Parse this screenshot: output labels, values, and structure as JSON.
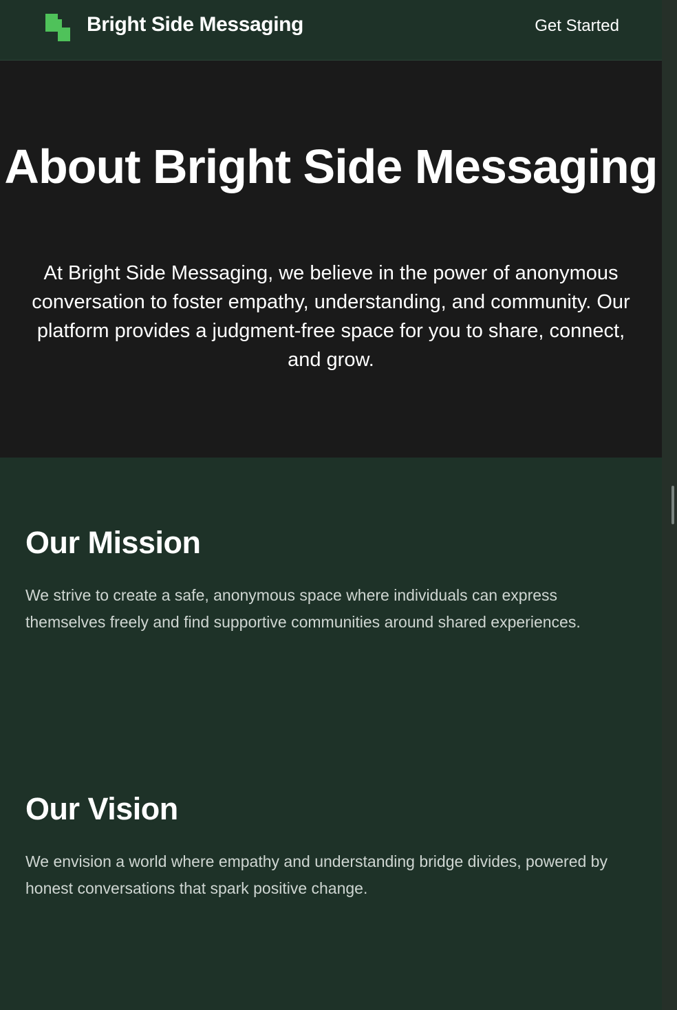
{
  "header": {
    "brand": "Bright Side Messaging",
    "cta_label": "Get Started",
    "logo_icon": "stacked-squares-logo-icon"
  },
  "hero": {
    "title": "About Bright Side Messaging",
    "description": "At Bright Side Messaging, we believe in the power of anonymous conversation to foster empathy, understanding, and community. Our platform provides a judgment-free space for you to share, connect, and grow."
  },
  "mission": {
    "heading": "Our Mission",
    "body": "We strive to create a safe, anonymous space where individuals can express themselves freely and find supportive communities around shared experiences."
  },
  "vision": {
    "heading": "Our Vision",
    "body": "We envision a world where empathy and understanding bridge divides, powered by honest conversations that spark positive change."
  },
  "colors": {
    "accent": "#4fc25a",
    "header_bg": "#1e3228",
    "hero_bg": "#1a1a1a",
    "section_bg": "#1e3228"
  }
}
